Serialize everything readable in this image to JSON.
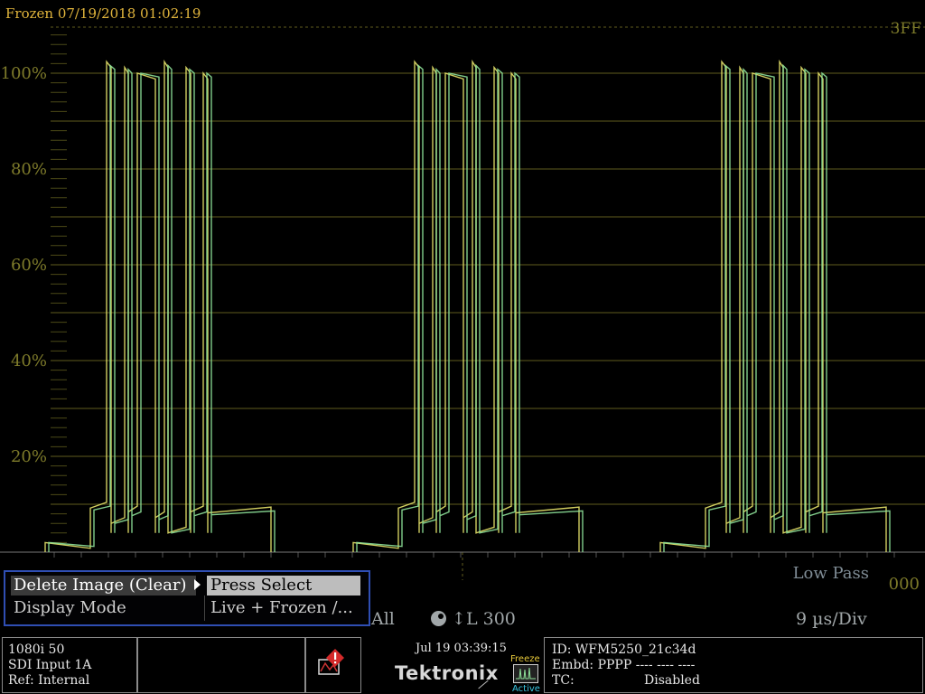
{
  "header": {
    "frozen_label": "Frozen 07/19/2018 01:02:19",
    "hex_top": "3FF",
    "hex_bottom": "000"
  },
  "graticule": {
    "y_labels": [
      "100%",
      "80%",
      "60%",
      "40%",
      "20%"
    ],
    "label_color": "#7d7a2a",
    "grid_color": "#5f5d1e"
  },
  "waveform": {
    "live_color": "#8fe39a",
    "frozen_color": "#e8e46a"
  },
  "filter_label": "Low Pass",
  "status": {
    "channel_mode": "All",
    "gain": "L 300",
    "timebase": "9 µs/Div"
  },
  "menu": {
    "item1_key": "Delete Image (Clear)",
    "item1_value": "Press Select",
    "item2_key": "Display Mode",
    "item2_value": "Live + Frozen /..."
  },
  "statusbar": {
    "format": "1080i 50",
    "input": "SDI Input 1A",
    "ref": "Ref: Internal",
    "date": "Jul 19 03:39:15",
    "brand": "Tektronix",
    "freeze_label": "Freeze",
    "active_label": "Active",
    "id": "ID: WFM5250_21c34d",
    "embd": "Embd: PPPP ---- ---- ----",
    "tc_label": "TC:",
    "tc_value": "Disabled"
  }
}
